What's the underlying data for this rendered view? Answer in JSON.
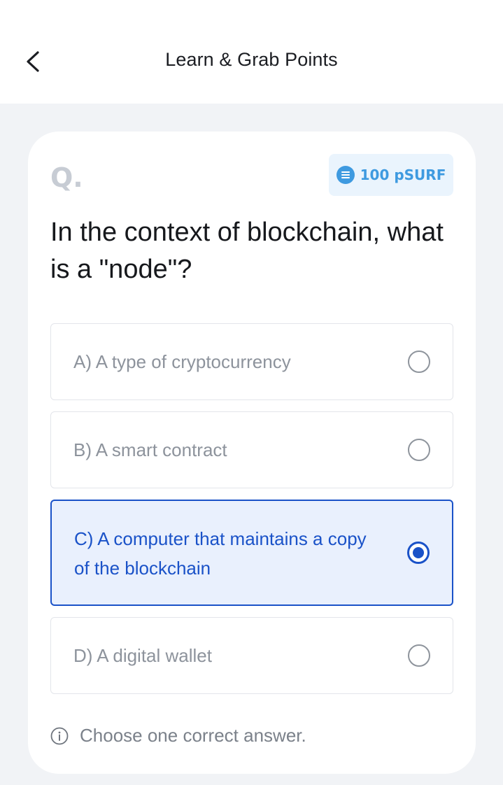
{
  "header": {
    "title": "Learn & Grab Points",
    "back_icon": "chevron-left-icon"
  },
  "question": {
    "label": "Q.",
    "text": "In the context of blockchain, what is a \"node\"?",
    "reward": {
      "text": "100 pSURF",
      "icon": "coin-icon",
      "color": "#3e9ae0"
    }
  },
  "options": [
    {
      "text": "A) A type of cryptocurrency",
      "selected": false
    },
    {
      "text": "B) A smart contract",
      "selected": false
    },
    {
      "text": "C) A computer that maintains a copy of the blockchain",
      "selected": true
    },
    {
      "text": "D) A digital wallet",
      "selected": false
    }
  ],
  "hint": {
    "text": "Choose one correct answer.",
    "icon": "info-icon"
  },
  "colors": {
    "accent": "#1a52c8",
    "selected_bg": "#e9f0fd",
    "page_bg": "#f1f3f6"
  }
}
